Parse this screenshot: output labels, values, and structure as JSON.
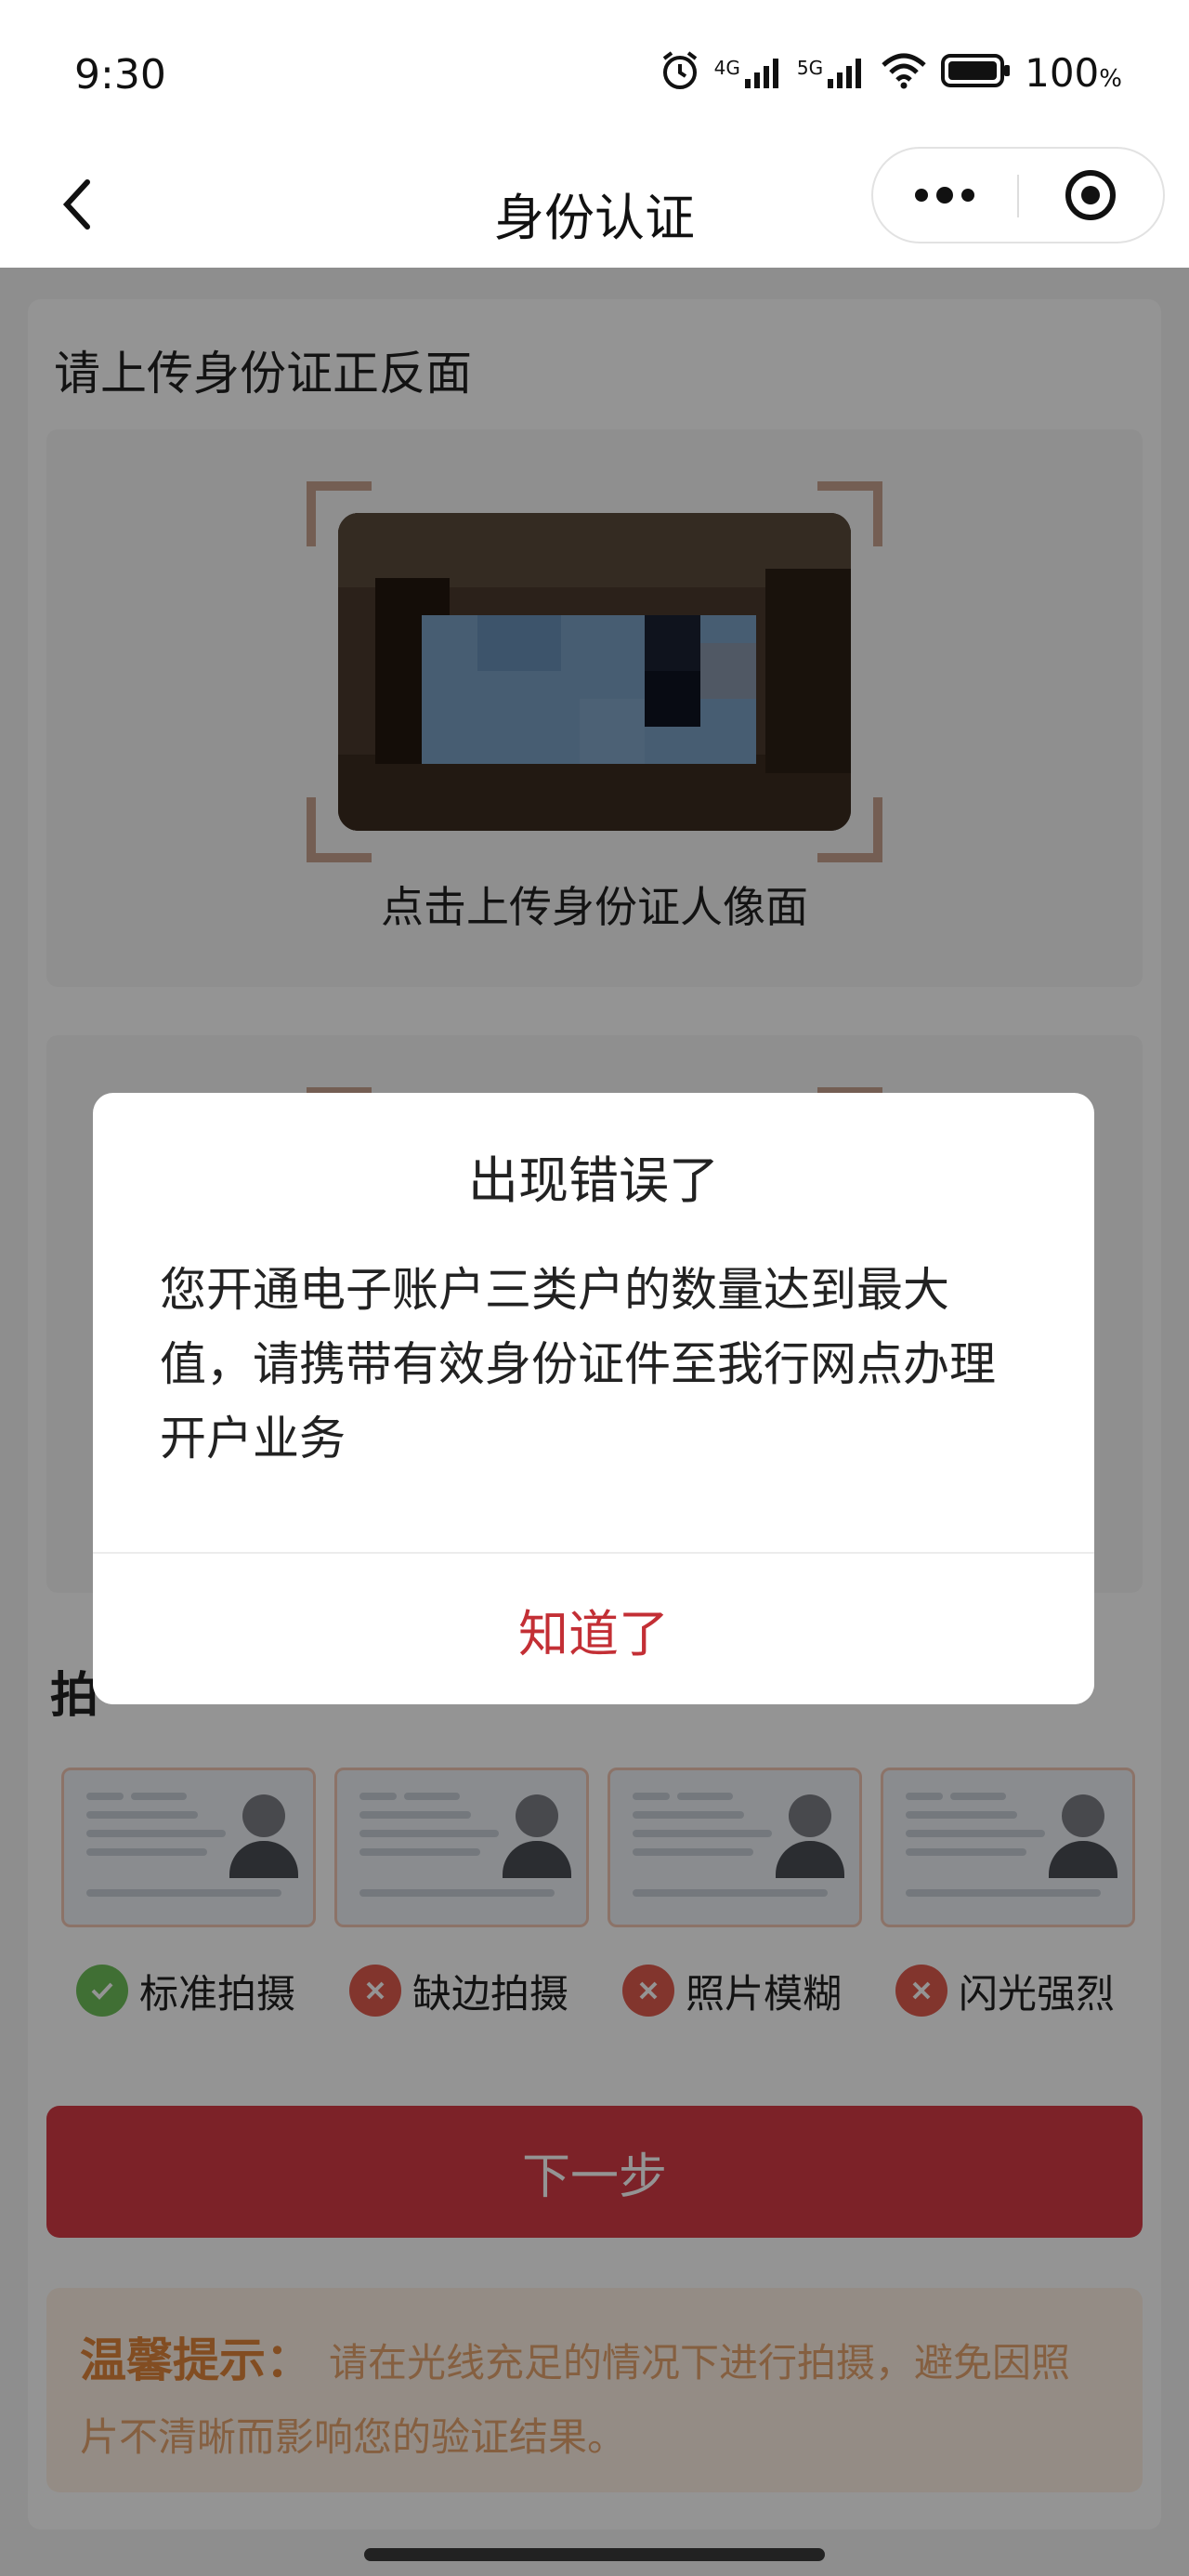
{
  "status_bar": {
    "time": "9:30",
    "network_4g": "4G",
    "network_5g": "5G",
    "battery_percent": "100",
    "battery_unit": "%"
  },
  "nav": {
    "title": "身份认证",
    "back_icon": "chevron-left-icon",
    "more_icon": "more-dots-icon",
    "close_icon": "target-circle-icon"
  },
  "upload": {
    "section_title": "请上传身份证正反面",
    "front_label": "点击上传身份证人像面"
  },
  "samples": {
    "section_title": "拍",
    "items": [
      {
        "label": "标准拍摄",
        "status": "ok"
      },
      {
        "label": "缺边拍摄",
        "status": "bad"
      },
      {
        "label": "照片模糊",
        "status": "bad"
      },
      {
        "label": "闪光强烈",
        "status": "bad"
      }
    ]
  },
  "next_button": "下一步",
  "tip": {
    "title": "温馨提示：",
    "text": "请在光线充足的情况下进行拍摄，避免因照片不清晰而影响您的验证结果。"
  },
  "dialog": {
    "title": "出现错误了",
    "message": "您开通电子账户三类户的数量达到最大值，请携带有效身份证件至我行网点办理开户业务",
    "confirm": "知道了"
  },
  "colors": {
    "accent_red": "#d63b46",
    "dialog_button": "#c32f35",
    "tip_title": "#e1863b",
    "ok_green": "#6fc05a",
    "error_red": "#e15c4f"
  }
}
